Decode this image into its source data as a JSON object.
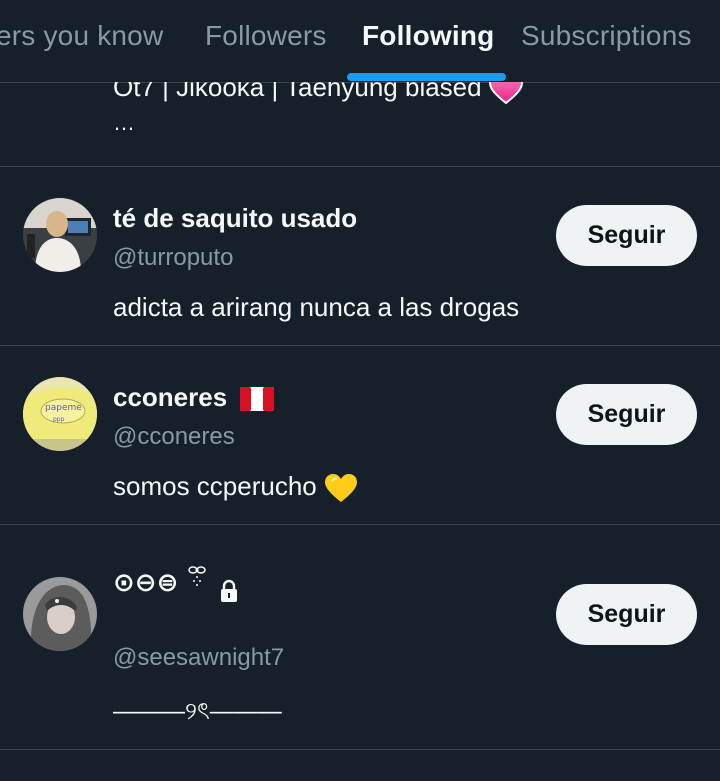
{
  "tabs": [
    {
      "label": "ers you know"
    },
    {
      "label": "Followers"
    },
    {
      "label": "Following"
    },
    {
      "label": "Subscriptions"
    }
  ],
  "active_tab": "Following",
  "partial_row": {
    "bio": "Ot7 | Jikooka | Taehyung biased",
    "more": "…"
  },
  "users": [
    {
      "name": "té de saquito usado",
      "handle": "@turroputo",
      "bio": "adicta a arirang nunca a las drogas",
      "button": "Seguir"
    },
    {
      "name": "cconeres",
      "handle": "@cconeres",
      "bio": "somos ccperucho",
      "button": "Seguir"
    },
    {
      "name": "⊙⊖⊜",
      "handle": "@seesawnight7",
      "bio": "———୨ৎ———",
      "button": "Seguir"
    }
  ],
  "colors": {
    "background": "#15202b",
    "accent": "#1d9bf0",
    "secondary_text": "#8b98a5",
    "button_bg": "#eff3f4"
  },
  "icons": {
    "heart": "pink-heart-icon",
    "flag": "peru-flag-icon",
    "yellow_heart": "yellow-heart-icon",
    "lock": "lock-icon"
  }
}
